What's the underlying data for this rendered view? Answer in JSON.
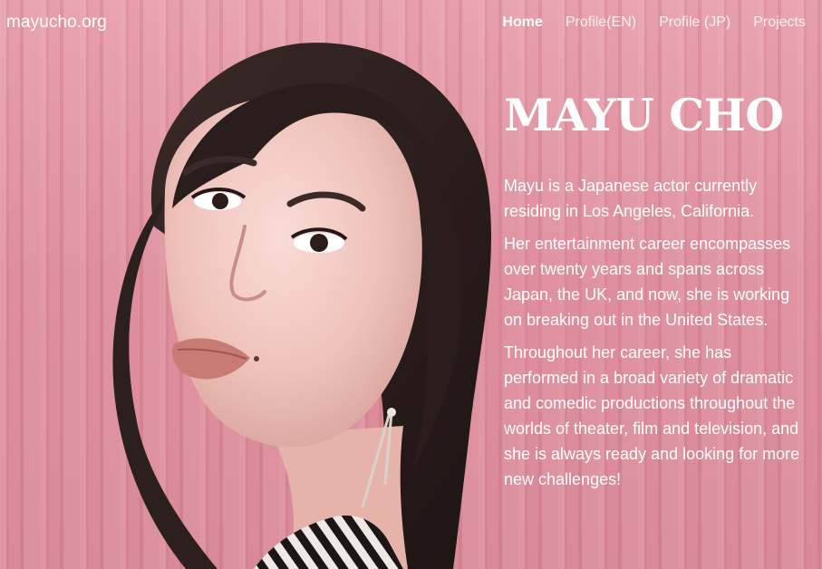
{
  "navbar": {
    "brand": "mayucho.org",
    "links": [
      {
        "label": "Home",
        "active": true
      },
      {
        "label": "Profile(EN)",
        "active": false
      },
      {
        "label": "Profile (JP)",
        "active": false
      },
      {
        "label": "Projects",
        "active": false
      }
    ]
  },
  "intro": {
    "name": "MAYU CHO",
    "paragraphs": [
      "Mayu is a Japanese actor currently residing in Los Angeles, California.",
      "Her entertainment career encompasses over twenty years and spans across Japan, the UK, and now, she is working on breaking out in the United States.",
      "Throughout her career, she has performed in a broad variety of dramatic and comedic productions throughout the worlds of theater, film and television, and she is always ready and looking for more new challenges!"
    ]
  },
  "colors": {
    "background_pink": "#de8f9d",
    "text": "#ffffff",
    "hair": "#2a1e1c",
    "skin": "#f2c8c2"
  }
}
